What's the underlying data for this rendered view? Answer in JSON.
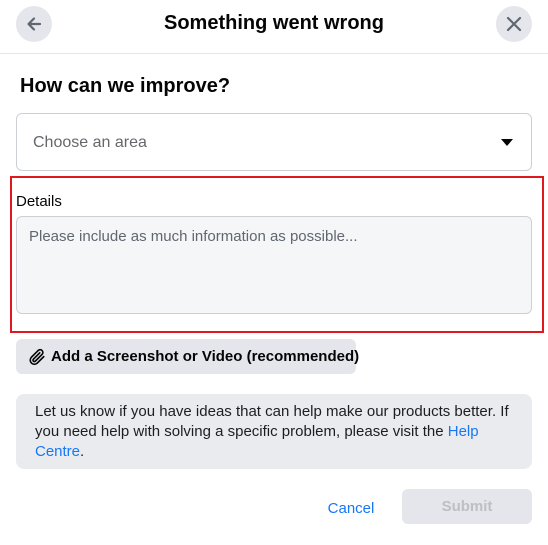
{
  "header": {
    "title": "Something went wrong",
    "back_icon": "arrow-left-icon",
    "close_icon": "close-icon"
  },
  "form": {
    "heading": "How can we improve?",
    "area_select": {
      "value": "Choose an area",
      "icon": "caret-down-icon"
    },
    "details": {
      "label": "Details",
      "placeholder": "Please include as much information as possible...",
      "value": ""
    },
    "attach_button": {
      "label": "Add a Screenshot or Video (recommended)",
      "icon": "paperclip-icon"
    },
    "info": {
      "text": "Let us know if you have ideas that can help make our products better. If you need help with solving a specific problem, please visit the ",
      "link_text": "Help Centre",
      "suffix": "."
    }
  },
  "footer": {
    "cancel_label": "Cancel",
    "submit_label": "Submit",
    "submit_enabled": false
  },
  "colors": {
    "link": "#1877f2",
    "highlight_border": "#e0191e",
    "button_bg": "#e4e6eb",
    "disabled_text": "#bcc0c4"
  }
}
